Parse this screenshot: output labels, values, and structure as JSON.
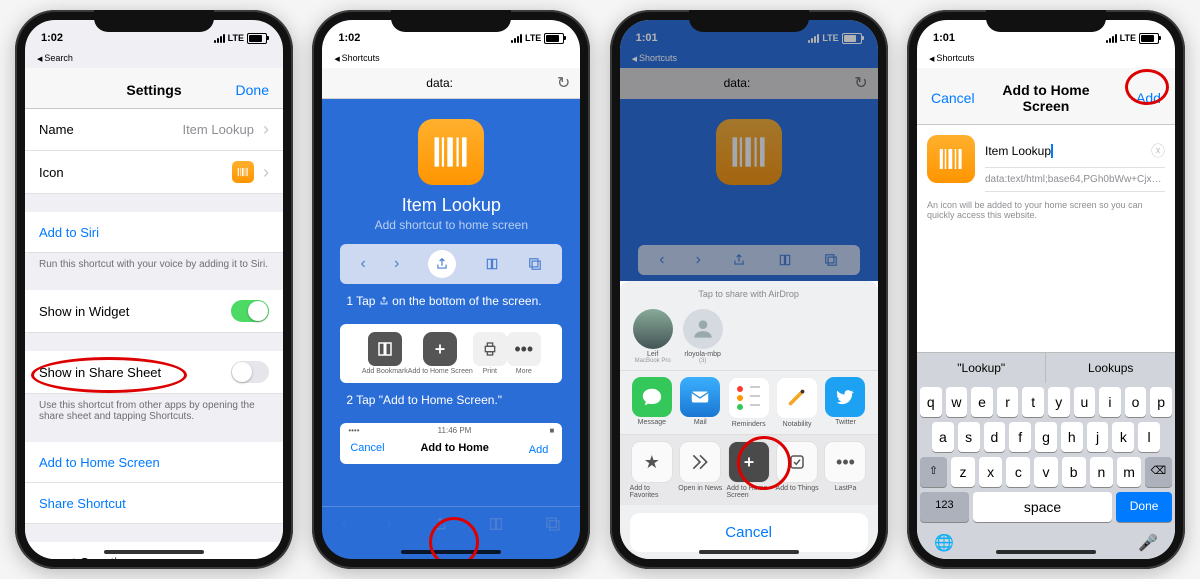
{
  "status": {
    "time1": "1:02",
    "time2": "1:02",
    "time3": "1:01",
    "time4": "1:01",
    "carrier": "LTE",
    "back1": "Search",
    "back2": "Shortcuts",
    "back3": "Shortcuts",
    "back4": "Shortcuts"
  },
  "screen1": {
    "title": "Settings",
    "done": "Done",
    "rows": {
      "name_label": "Name",
      "name_value": "Item Lookup",
      "icon_label": "Icon",
      "siri": "Add to Siri",
      "siri_note": "Run this shortcut with your voice by adding it to Siri.",
      "widget": "Show in Widget",
      "share_sheet": "Show in Share Sheet",
      "share_note": "Use this shortcut from other apps by opening the share sheet and tapping Shortcuts.",
      "add_home": "Add to Home Screen",
      "share_shortcut": "Share Shortcut",
      "import": "Import Questions"
    }
  },
  "screen2": {
    "url": "data:",
    "title": "Item Lookup",
    "subtitle": "Add shortcut to home screen",
    "step1_pre": "1  Tap",
    "step1_post": "on the bottom of the screen.",
    "step2": "2   Tap \"Add to Home Screen.\"",
    "share_items": {
      "bookmark": "Add Bookmark",
      "home": "Add to Home Screen",
      "print": "Print",
      "more": "More"
    },
    "mini_time": "11:46 PM",
    "mini_cancel": "Cancel",
    "mini_title": "Add to Home",
    "mini_add": "Add"
  },
  "screen3": {
    "url": "data:",
    "sheet_head": "Tap to share with AirDrop",
    "airdrop": [
      {
        "name": "Leif",
        "sub": "MacBook Pro"
      },
      {
        "name": "rloyola-mbp",
        "sub": "(3)"
      }
    ],
    "apps": [
      {
        "name": "Message",
        "color": "#34c759",
        "glyph": "message"
      },
      {
        "name": "Mail",
        "color": "#1f9cef",
        "glyph": "mail"
      },
      {
        "name": "Reminders",
        "color": "#ffffff",
        "glyph": "reminders"
      },
      {
        "name": "Notability",
        "color": "#ffcc00",
        "glyph": "pencil"
      },
      {
        "name": "Twitter",
        "color": "#1da1f2",
        "glyph": "twitter"
      }
    ],
    "actions": [
      {
        "name": "Add to Favorites",
        "glyph": "star"
      },
      {
        "name": "Open in News",
        "glyph": "news"
      },
      {
        "name": "Add to Home Screen",
        "glyph": "plus"
      },
      {
        "name": "Add to Things",
        "glyph": "check"
      },
      {
        "name": "LastPa",
        "glyph": "dots"
      }
    ],
    "cancel": "Cancel"
  },
  "screen4": {
    "cancel": "Cancel",
    "title": "Add to Home Screen",
    "add": "Add",
    "name_value": "Item Lookup",
    "url_value": "data:text/html;base64,PGh0bWw+Cjx…",
    "help": "An icon will be added to your home screen so you can quickly access this website.",
    "suggestions": [
      "\"Lookup\"",
      "Lookups"
    ],
    "keys_r1": [
      "q",
      "w",
      "e",
      "r",
      "t",
      "y",
      "u",
      "i",
      "o",
      "p"
    ],
    "keys_r2": [
      "a",
      "s",
      "d",
      "f",
      "g",
      "h",
      "j",
      "k",
      "l"
    ],
    "keys_r3": [
      "z",
      "x",
      "c",
      "v",
      "b",
      "n",
      "m"
    ],
    "num_key": "123",
    "space": "space",
    "done": "Done"
  }
}
